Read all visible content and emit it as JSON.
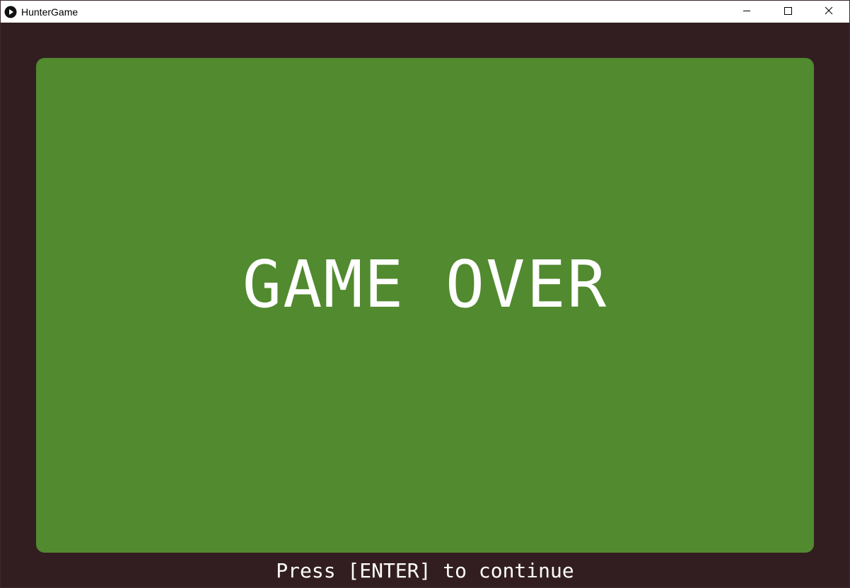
{
  "window": {
    "title": "HunterGame",
    "icons": {
      "app": "play-icon",
      "minimize": "minimize-icon",
      "maximize": "maximize-icon",
      "close": "close-icon"
    }
  },
  "game": {
    "headline": "GAME OVER",
    "prompt": "Press [ENTER] to continue"
  },
  "colors": {
    "background": "#321e20",
    "panel": "#518a2f",
    "text": "#ffffff"
  }
}
